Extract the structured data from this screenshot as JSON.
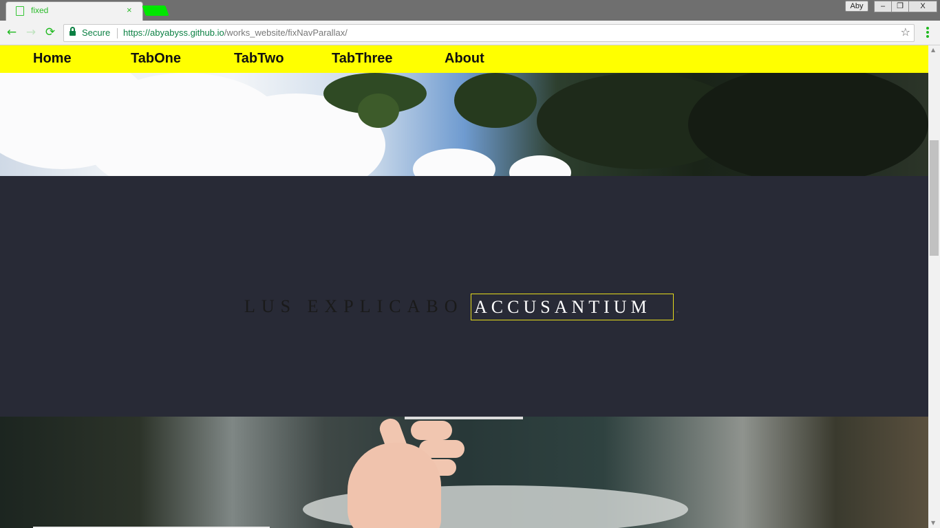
{
  "browser": {
    "tab": {
      "title": "fixed",
      "close_label": "×",
      "favicon": "page-icon"
    },
    "profile_label": "Aby",
    "window_buttons": {
      "minimize": "–",
      "maximize": "❐",
      "close": "X"
    },
    "nav": {
      "back": "←",
      "forward": "→",
      "reload": "⟳"
    },
    "address": {
      "secure_label": "Secure",
      "scheme": "https://",
      "host": "abyabyss.github.io",
      "path": "/works_website/fixNavParallax/"
    },
    "bookmark_icon": "☆",
    "accent_color": "#1fb91f"
  },
  "page": {
    "nav_links": [
      "Home",
      "TabOne",
      "TabTwo",
      "TabThree",
      "About"
    ],
    "nav_color": "#ffff00",
    "headline_prefix": "LUS EXPLICABO",
    "headline_highlight": "ACCUSANTIUM",
    "headline_suffix": ".",
    "section_bg": "#282a36",
    "highlight_border": "#e7dd1c"
  },
  "scrollbar": {
    "up": "▲",
    "down": "▼"
  }
}
